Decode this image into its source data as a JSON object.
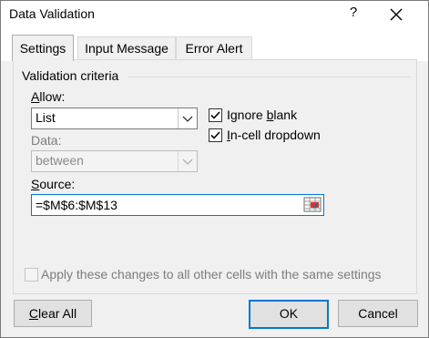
{
  "window": {
    "title": "Data Validation",
    "help_glyph": "?"
  },
  "tabs": [
    {
      "label": "Settings",
      "active": true
    },
    {
      "label": "Input Message",
      "active": false
    },
    {
      "label": "Error Alert",
      "active": false
    }
  ],
  "criteria": {
    "group_label": "Validation criteria",
    "allow": {
      "label_prefix": "",
      "label_mnemonic": "A",
      "label_rest": "llow:",
      "value": "List"
    },
    "data": {
      "label": "Data:",
      "value": "between"
    },
    "source": {
      "label_mnemonic": "S",
      "label_rest": "ource:",
      "value": "=$M$6:$M$13"
    },
    "ignore_blank": {
      "label_before": "Ignore ",
      "label_mnemonic": "b",
      "label_rest": "lank",
      "checked": true
    },
    "incell_dropdown": {
      "label_mnemonic": "I",
      "label_rest": "n-cell dropdown",
      "checked": true
    }
  },
  "apply_all": {
    "label": "Apply these changes to all other cells with the same settings",
    "checked": false
  },
  "buttons": {
    "clear_all": {
      "mnemonic": "C",
      "rest": "lear All"
    },
    "ok": "OK",
    "cancel": "Cancel"
  }
}
